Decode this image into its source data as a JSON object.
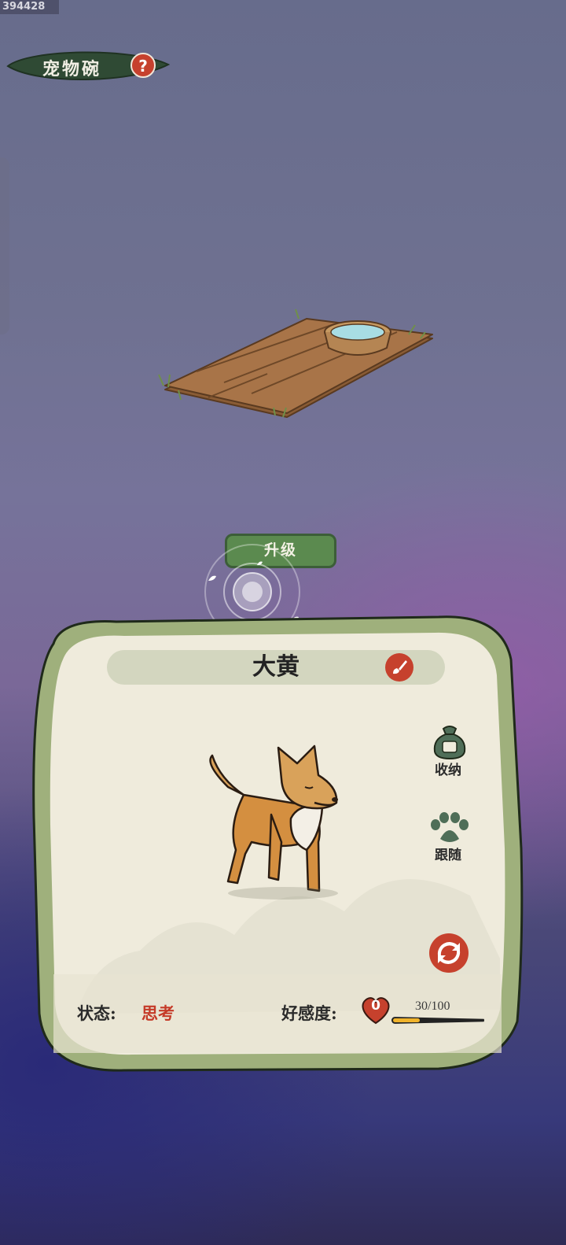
{
  "screen_id": "394428",
  "header": {
    "title": "宠物碗",
    "help_icon": "question-icon"
  },
  "scene": {
    "item": "pet-bowl-on-wooden-platform"
  },
  "upgrade": {
    "label": "升级"
  },
  "pet": {
    "name": "大黄",
    "actions": [
      {
        "label": "收纳",
        "icon": "bag-icon"
      },
      {
        "label": "跟随",
        "icon": "paw-icon"
      }
    ],
    "status_label": "状态:",
    "status_value": "思考",
    "affinity_label": "好感度:",
    "affinity_level": "0",
    "affinity_text": "30/100",
    "affinity_fraction": 0.3
  },
  "colors": {
    "accent_red": "#c6412d",
    "leaf_green": "#2f4a34",
    "button_green": "#5b8a4f",
    "paper": "#efebdc",
    "bar_fill": "#f0b32c"
  }
}
